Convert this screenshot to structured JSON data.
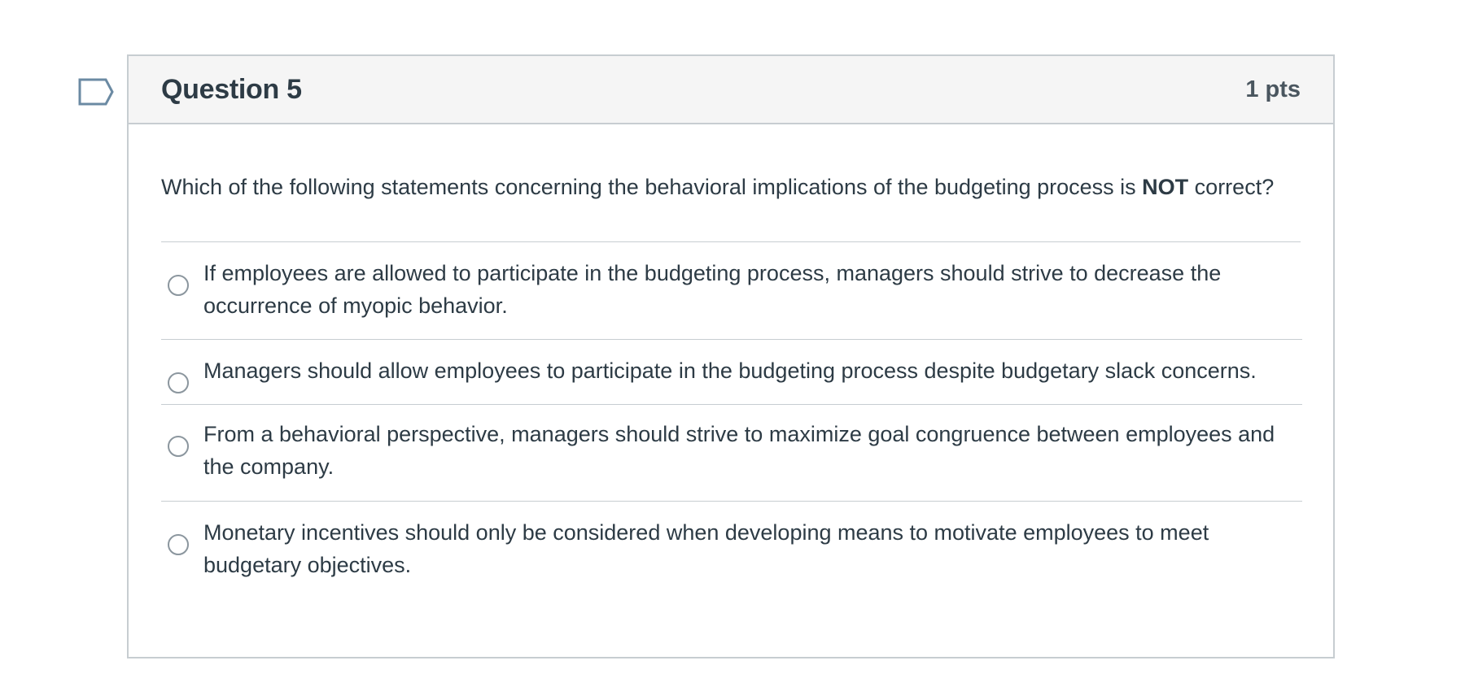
{
  "question": {
    "title": "Question 5",
    "points": "1 pts",
    "text_before": "Which of the following statements concerning the behavioral implications of the budgeting process is ",
    "text_emphasis": "NOT",
    "text_after": " correct?",
    "flag_icon": "bookmark-flag-icon"
  },
  "answers": [
    {
      "label": "If employees are allowed to participate in the budgeting process, managers should strive to decrease the occurrence of myopic behavior.",
      "selected": false
    },
    {
      "label": "Managers should allow employees to participate in the budgeting process despite budgetary slack concerns.",
      "selected": false
    },
    {
      "label": "From a behavioral perspective, managers should strive to maximize goal congruence between employees and the company.",
      "selected": false
    },
    {
      "label": "Monetary incentives should only be considered when developing means to motivate employees to meet budgetary objectives.",
      "selected": false
    }
  ],
  "colors": {
    "text": "#2d3b45",
    "border": "#c7cdd1",
    "header_bg": "#f5f5f5",
    "flag_stroke": "#6b8aa3"
  }
}
